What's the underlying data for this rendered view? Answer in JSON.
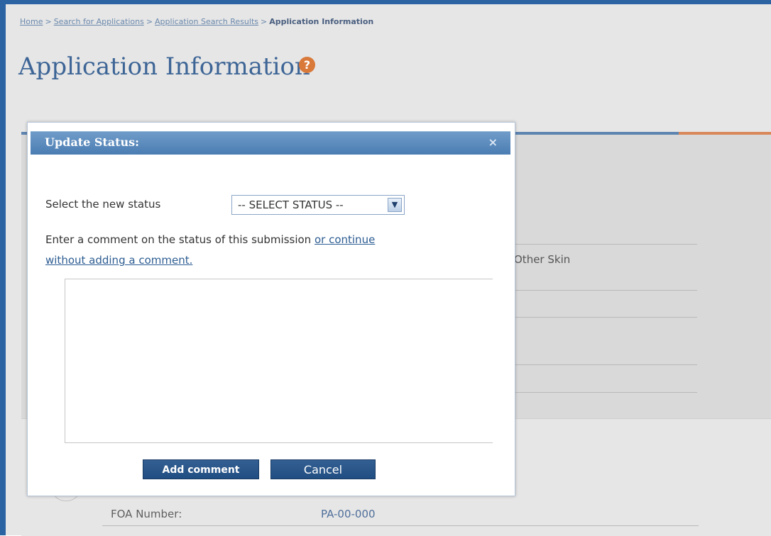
{
  "breadcrumb": {
    "items": [
      "Home",
      "Search for Applications",
      "Application Search Results"
    ],
    "current": "Application Information",
    "separator": ">"
  },
  "page": {
    "title": "Application Information",
    "help_icon": "question-mark-icon"
  },
  "background": {
    "partial_text": "Other Skin",
    "foa_label": "FOA Number:",
    "foa_value": "PA-00-000"
  },
  "modal": {
    "title": "Update Status:",
    "close_glyph": "×",
    "status_label": "Select the new status",
    "status_select": {
      "selected": "-- SELECT STATUS --"
    },
    "comment_prompt": "Enter a comment on the status of this submission",
    "comment_link_part1": "or continue",
    "comment_link_part2": "without adding a comment.",
    "textarea_value": "",
    "add_button": "Add comment",
    "cancel_button": "Cancel"
  },
  "colors": {
    "accent_blue": "#2b63a3",
    "header_blue": "#4b7db3",
    "button_blue": "#214e82",
    "orange": "#d9793a"
  }
}
